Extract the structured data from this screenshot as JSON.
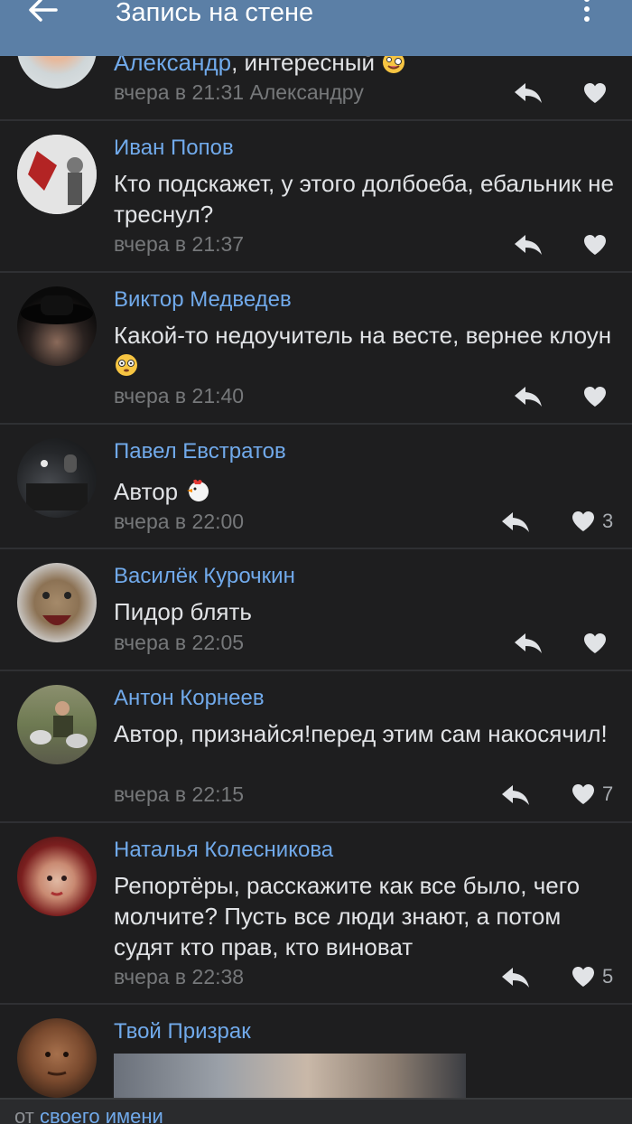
{
  "header": {
    "title": "Запись на стене"
  },
  "comments": [
    {
      "author": "Александр",
      "text": ", интересный",
      "time": "вчера в 21:31",
      "reply_to": "Александру",
      "likes": ""
    },
    {
      "author": "Иван Попов",
      "text": "Кто подскажет, у этого долбоеба, ебальник не треснул?",
      "time": "вчера в 21:37",
      "likes": ""
    },
    {
      "author": "Виктор Медведев",
      "text": "Какой-то недоучитель на весте, вернее клоун",
      "time": "вчера в 21:40",
      "likes": ""
    },
    {
      "author": "Павел Евстратов",
      "text": "Автор",
      "time": "вчера в 22:00",
      "likes": "3"
    },
    {
      "author": "Василёк Курочкин",
      "text": "Пидор блять",
      "time": "вчера в 22:05",
      "likes": ""
    },
    {
      "author": "Антон Корнеев",
      "text": "Автор, признайся!перед этим сам накосячил!",
      "time": "вчера в 22:15",
      "likes": "7"
    },
    {
      "author": "Наталья Колесникова",
      "text": "Репортёры, расскажите как все было, чего молчите? Пусть все люди знают, а потом судят кто прав, кто виноват",
      "time": "вчера в 22:38",
      "likes": "5"
    },
    {
      "author": "Твой Призрак",
      "text": "",
      "time": "",
      "likes": ""
    }
  ],
  "footer": {
    "prefix": "от",
    "link": "своего имени"
  },
  "colors": {
    "header": "#5b7fa6",
    "background": "#1e1e1f",
    "author": "#71aaeb",
    "meta": "#76787a"
  },
  "icons": [
    "back-arrow-icon",
    "more-vertical-icon",
    "reply-icon",
    "heart-icon"
  ]
}
